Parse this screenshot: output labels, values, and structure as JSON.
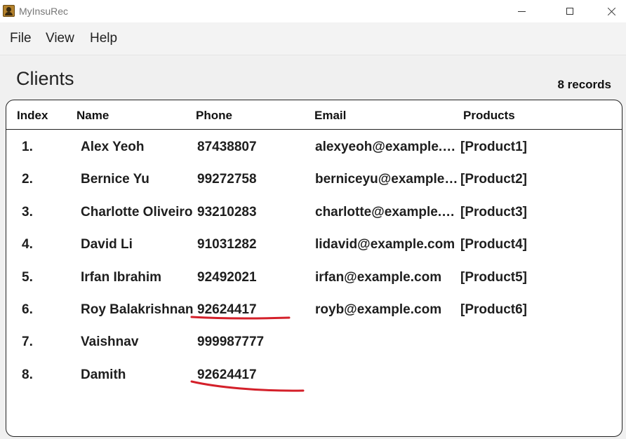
{
  "window": {
    "title": "MyInsuRec",
    "icon": "app-icon"
  },
  "menu": {
    "items": [
      {
        "label": "File"
      },
      {
        "label": "View"
      },
      {
        "label": "Help"
      }
    ]
  },
  "page": {
    "title": "Clients",
    "record_count": "8 records"
  },
  "table": {
    "headers": {
      "index": "Index",
      "name": "Name",
      "phone": "Phone",
      "email": "Email",
      "products": "Products"
    },
    "rows": [
      {
        "index": "1.",
        "name": "Alex Yeoh",
        "phone": "87438807",
        "email": "alexyeoh@example.com",
        "products": "[Product1]"
      },
      {
        "index": "2.",
        "name": "Bernice Yu",
        "phone": "99272758",
        "email": "berniceyu@example.com",
        "products": "[Product2]"
      },
      {
        "index": "3.",
        "name": "Charlotte Oliveiro",
        "phone": "93210283",
        "email": "charlotte@example.com",
        "products": "[Product3]"
      },
      {
        "index": "4.",
        "name": "David Li",
        "phone": "91031282",
        "email": "lidavid@example.com",
        "products": "[Product4]"
      },
      {
        "index": "5.",
        "name": "Irfan Ibrahim",
        "phone": "92492021",
        "email": "irfan@example.com",
        "products": "[Product5]"
      },
      {
        "index": "6.",
        "name": "Roy Balakrishnan",
        "phone": "92624417",
        "email": "royb@example.com",
        "products": "[Product6]"
      },
      {
        "index": "7.",
        "name": "Vaishnav",
        "phone": "999987777",
        "email": "",
        "products": ""
      },
      {
        "index": "8.",
        "name": "Damith",
        "phone": "92624417",
        "email": "",
        "products": ""
      }
    ]
  },
  "colors": {
    "annotation": "#d4202a",
    "panel_border": "#222222",
    "background": "#f0f0f0"
  }
}
